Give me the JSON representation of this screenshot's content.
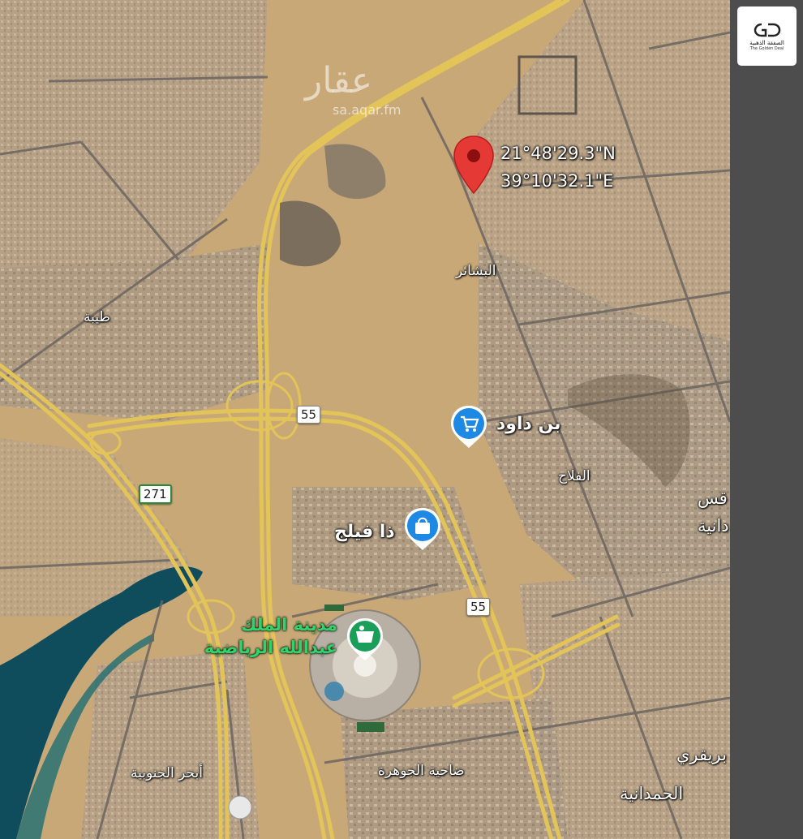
{
  "map": {
    "watermark": {
      "text": "عقار",
      "url": "sa.aqar.fm"
    },
    "pin": {
      "lat": "21°48'29.3\"N",
      "lng": "39°10'32.1\"E",
      "color": "#e53935"
    },
    "neighborhoods": {
      "basha": "البشائر",
      "taiba": "طيبة",
      "falah": "الفلاح",
      "abhar": "أبحر الجنوبية",
      "jawhara": "ضاحية الجوهرة",
      "hamdania": "الحمدانية",
      "buraiqi": "بريقري",
      "edge1": "قس",
      "edge2": "دانية"
    },
    "poi": {
      "bindawood": {
        "name": "بن داود",
        "icon": "shopping-cart-icon",
        "color": "#1e88e5"
      },
      "thefeelig": {
        "name": "ذا فيلج",
        "icon": "shopping-bag-icon",
        "color": "#1e88e5"
      },
      "stadium": {
        "line1": "مدينة الملك",
        "line2": "عبدالله الرياضية",
        "icon": "stadium-icon",
        "color": "#1b9e5a"
      }
    },
    "roads": {
      "r55_a": "55",
      "r55_b": "55",
      "r271": "271"
    }
  },
  "brand": {
    "name_ar": "الصفقة الذهبية",
    "name_en": "The Golden Deal"
  },
  "colors": {
    "desert": "#c8a97c",
    "urban": "#a89a8a",
    "highway": "#e6c85a",
    "sea": "#0e4a5c"
  }
}
